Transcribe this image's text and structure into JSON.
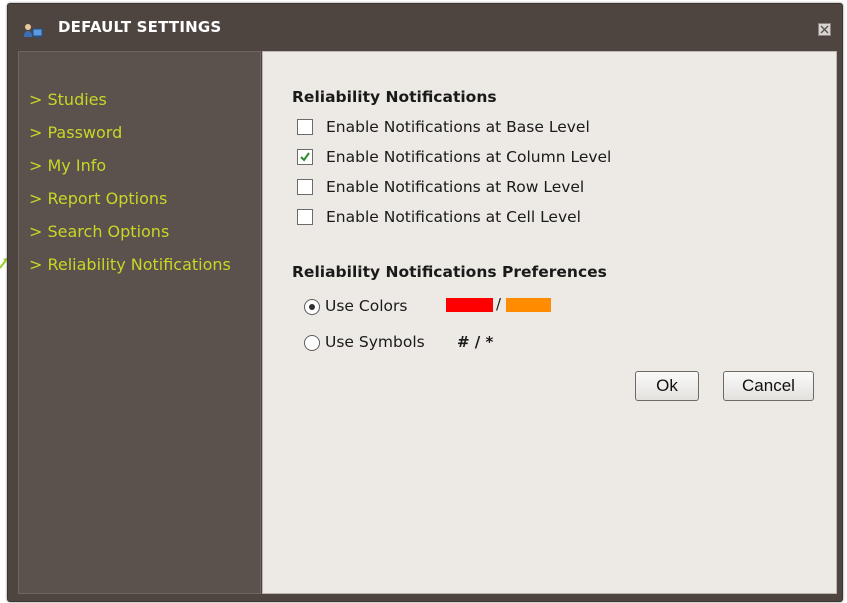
{
  "window": {
    "title": "DEFAULT SETTINGS",
    "icon": "user-settings-icon",
    "close_icon": "close-icon"
  },
  "sidebar": {
    "items": [
      {
        "label": "> Studies"
      },
      {
        "label": "> Password"
      },
      {
        "label": "> My Info"
      },
      {
        "label": "> Report Options"
      },
      {
        "label": "> Search Options"
      },
      {
        "label": "> Reliability Notifications"
      }
    ],
    "active_index": 5
  },
  "notifications": {
    "title": "Reliability Notifications",
    "options": [
      {
        "label": "Enable Notifications at Base Level",
        "checked": false
      },
      {
        "label": "Enable Notifications at Column Level",
        "checked": true
      },
      {
        "label": "Enable Notifications at Row Level",
        "checked": false
      },
      {
        "label": "Enable Notifications at Cell Level",
        "checked": false
      }
    ]
  },
  "preferences": {
    "title": "Reliability Notifications Preferences",
    "use_colors": {
      "label": "Use Colors",
      "selected": true
    },
    "colors": {
      "primary": "#ff0000",
      "separator": "/",
      "secondary": "#ff8c00"
    },
    "use_symbols": {
      "label": "Use Symbols",
      "selected": false
    },
    "symbols_text": "# / *"
  },
  "buttons": {
    "ok": "Ok",
    "cancel": "Cancel"
  },
  "colors": {
    "sidebar_text": "#c6d826",
    "window_bg": "#4e4541",
    "content_bg": "#ede9e4"
  }
}
